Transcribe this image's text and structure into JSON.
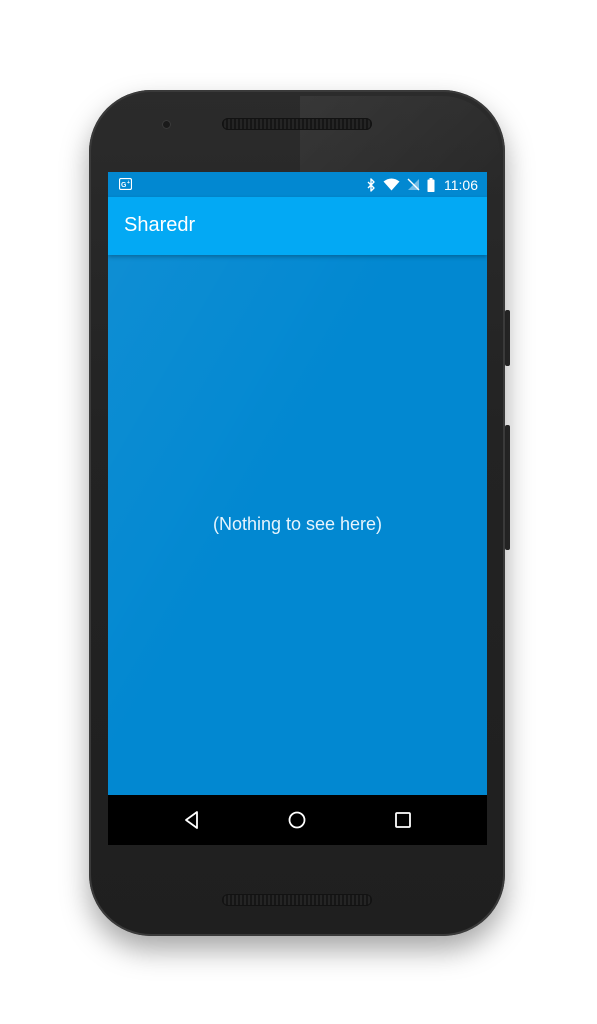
{
  "status_bar": {
    "notification_icon": "google-plus-icon",
    "icons": [
      "bluetooth-icon",
      "wifi-icon",
      "no-sim-icon",
      "battery-icon"
    ],
    "time": "11:06"
  },
  "app_bar": {
    "title": "Sharedr"
  },
  "content": {
    "empty_message": "(Nothing to see here)"
  },
  "nav_bar": {
    "buttons": [
      "back-icon",
      "home-icon",
      "recents-icon"
    ]
  },
  "colors": {
    "primary_dark": "#0288d1",
    "primary": "#03a9f4",
    "nav_bar": "#000000",
    "text_on_primary": "#ffffff"
  }
}
